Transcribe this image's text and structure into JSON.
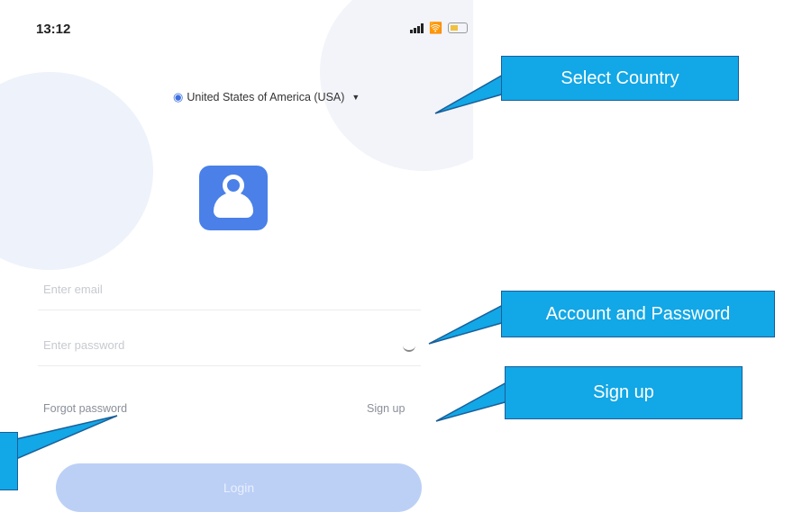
{
  "status": {
    "time": "13:12"
  },
  "country": {
    "selected": "United States of America (USA)"
  },
  "app_logo_icon": "user-cloud-icon",
  "form": {
    "email_placeholder": "Enter email",
    "password_placeholder": "Enter password",
    "forgot_label": "Forgot password",
    "signup_label": "Sign up",
    "login_label": "Login"
  },
  "callouts": {
    "country": "Select Country",
    "account": "Account and Password",
    "signup": "Sign up"
  },
  "colors": {
    "callout_fill": "#12a7e6",
    "callout_border": "#1a5f9a",
    "accent": "#4a80e8",
    "login_button": "#bcd0f6"
  }
}
